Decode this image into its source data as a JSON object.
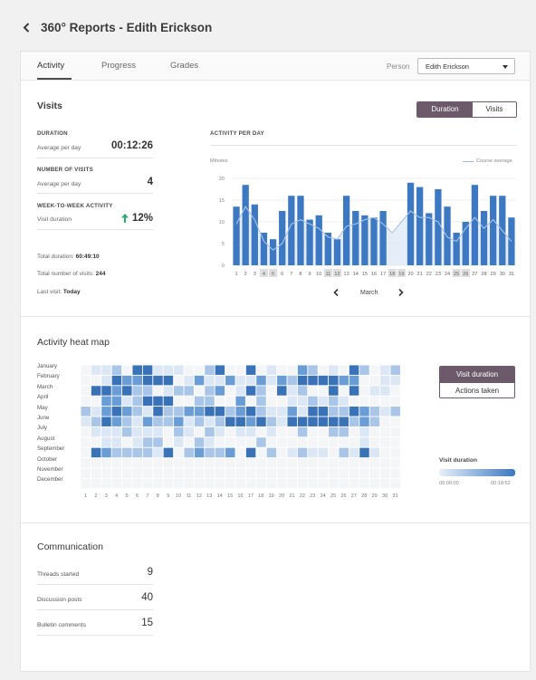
{
  "header": {
    "title": "360° Reports - Edith Erickson"
  },
  "tabs": [
    {
      "label": "Activity",
      "active": true
    },
    {
      "label": "Progress",
      "active": false
    },
    {
      "label": "Grades",
      "active": false
    }
  ],
  "person": {
    "label": "Person",
    "selected": "Edith Erickson"
  },
  "visits": {
    "title": "Visits",
    "toggle": {
      "duration": "Duration",
      "visits": "Visits"
    },
    "metrics": [
      {
        "head": "DURATION",
        "sub": "Average per day",
        "value": "00:12:26"
      },
      {
        "head": "NUMBER OF VISITS",
        "sub": "Average per day",
        "value": "4"
      },
      {
        "head": "WEEK-TO-WEEK ACTIVITY",
        "sub": "Visit duration",
        "value": "12%"
      }
    ],
    "totals": {
      "duration_label": "Total duration:",
      "duration_value": "60:49:10",
      "visits_label": "Total number of visits:",
      "visits_value": "244",
      "last_label": "Last visit:",
      "last_value": "Today"
    }
  },
  "activity_chart": {
    "heading": "ACTIVITY PER DAY",
    "unit": "Minutes",
    "legend": "Course average",
    "month": "March"
  },
  "chart_data": {
    "type": "bar",
    "title": "ACTIVITY PER DAY",
    "ylabel": "Minutes",
    "ylim": [
      0,
      20
    ],
    "yticks": [
      0,
      5,
      10,
      15,
      20
    ],
    "categories": [
      "1",
      "2",
      "3",
      "4",
      "5",
      "6",
      "7",
      "8",
      "9",
      "10",
      "11",
      "12",
      "13",
      "14",
      "15",
      "16",
      "17",
      "18",
      "19",
      "20",
      "21",
      "22",
      "23",
      "24",
      "25",
      "26",
      "27",
      "28",
      "29",
      "30",
      "31"
    ],
    "highlighted_days": [
      "4",
      "5",
      "11",
      "12",
      "18",
      "19",
      "25",
      "26"
    ],
    "series": [
      {
        "name": "",
        "values": [
          13.5,
          18.5,
          14,
          7.5,
          6,
          12.5,
          16,
          16,
          10.5,
          11.5,
          7.5,
          6,
          16,
          12.5,
          11.5,
          11,
          12.5,
          0,
          0,
          19,
          18,
          12,
          17.5,
          13.5,
          7.5,
          10,
          18.5,
          12.5,
          16,
          16,
          11
        ]
      },
      {
        "name": "Course average",
        "values": [
          9.5,
          13.5,
          10.5,
          5.5,
          3.5,
          5,
          9.5,
          10.5,
          9.5,
          8.5,
          6.5,
          6,
          9,
          9.5,
          10.5,
          11,
          9.5,
          7.5,
          10,
          12.5,
          11,
          11,
          10,
          6.5,
          5.5,
          8.5,
          11,
          8.5,
          10.5,
          8,
          5.5
        ]
      }
    ]
  },
  "heatmap": {
    "title": "Activity heat map",
    "months": [
      "January",
      "February",
      "March",
      "April",
      "May",
      "June",
      "July",
      "August",
      "September",
      "October",
      "November",
      "December"
    ],
    "days": [
      "1",
      "2",
      "3",
      "4",
      "5",
      "6",
      "7",
      "8",
      "9",
      "10",
      "11",
      "12",
      "13",
      "14",
      "15",
      "16",
      "17",
      "18",
      "19",
      "20",
      "21",
      "22",
      "23",
      "24",
      "25",
      "26",
      "27",
      "28",
      "29",
      "30",
      "31"
    ],
    "toggle": {
      "visit_duration": "Visit duration",
      "actions_taken": "Actions taken"
    },
    "legend_title": "Visit duration",
    "legend_min": "00:00:00",
    "legend_max": "00:18:52",
    "colors": [
      "#f4f5f7",
      "#dce7f5",
      "#a9c6e8",
      "#6a9dd6",
      "#3a72b8",
      "#255a9c"
    ]
  },
  "communication": {
    "title": "Communication",
    "items": [
      {
        "label": "Threads started",
        "value": "9"
      },
      {
        "label": "Discussion posts",
        "value": "40"
      },
      {
        "label": "Bulletin comments",
        "value": "15"
      }
    ]
  }
}
